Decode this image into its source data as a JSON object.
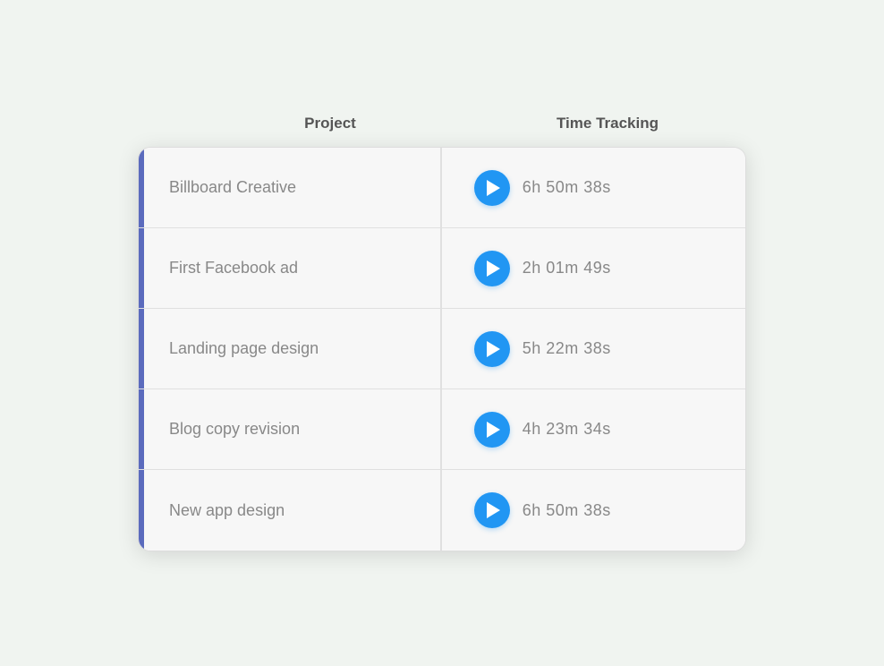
{
  "header": {
    "project_label": "Project",
    "time_label": "Time Tracking"
  },
  "rows": [
    {
      "id": "billboard-creative",
      "project": "Billboard Creative",
      "time": "6h  50m  38s"
    },
    {
      "id": "first-facebook-ad",
      "project": "First Facebook ad",
      "time": "2h  01m  49s"
    },
    {
      "id": "landing-page-design",
      "project": "Landing page design",
      "time": "5h  22m  38s"
    },
    {
      "id": "blog-copy-revision",
      "project": "Blog copy revision",
      "time": "4h  23m  34s"
    },
    {
      "id": "new-app-design",
      "project": "New app design",
      "time": "6h  50m  38s"
    }
  ]
}
